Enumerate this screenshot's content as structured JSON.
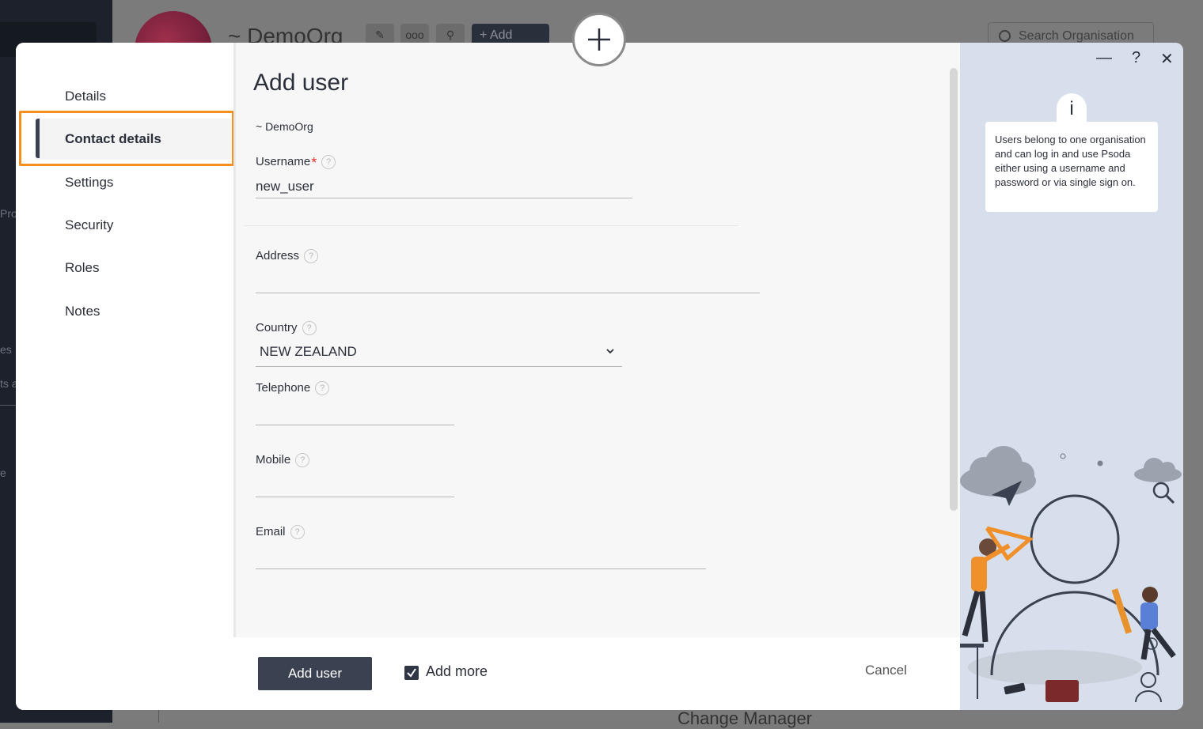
{
  "background": {
    "org_title": "~ DemoOrg",
    "add_button": "+ Add",
    "search_placeholder": "Search Organisation",
    "side_texts": [
      "Pro",
      "es",
      "ts a",
      "e"
    ],
    "bottom_text": "Change Manager"
  },
  "modal": {
    "nav": {
      "items": [
        {
          "label": "Details"
        },
        {
          "label": "Contact details",
          "active": true
        },
        {
          "label": "Settings"
        },
        {
          "label": "Security"
        },
        {
          "label": "Roles"
        },
        {
          "label": "Notes"
        }
      ]
    },
    "form": {
      "title": "Add user",
      "org": "~ DemoOrg",
      "username": {
        "label": "Username",
        "value": "new_user",
        "required": true
      },
      "address": {
        "label": "Address",
        "value": ""
      },
      "country": {
        "label": "Country",
        "value": "NEW ZEALAND"
      },
      "telephone": {
        "label": "Telephone",
        "value": ""
      },
      "mobile": {
        "label": "Mobile",
        "value": ""
      },
      "email": {
        "label": "Email",
        "value": ""
      },
      "help_glyph": "?"
    },
    "footer": {
      "add_user_label": "Add user",
      "add_more_label": "Add more",
      "add_more_checked": true,
      "cancel_label": "Cancel"
    },
    "help_panel": {
      "info_glyph": "i",
      "text": "Users belong to one organisation and can log in and use Psoda either using a username and password or via single sign on.",
      "controls": {
        "minimize": "—",
        "help": "?",
        "close": "✕"
      }
    }
  },
  "colors": {
    "accent_orange": "#f5901e",
    "primary_dark": "#3a4150",
    "required_red": "#e0332c",
    "panel_blue": "#d6dfeb"
  }
}
